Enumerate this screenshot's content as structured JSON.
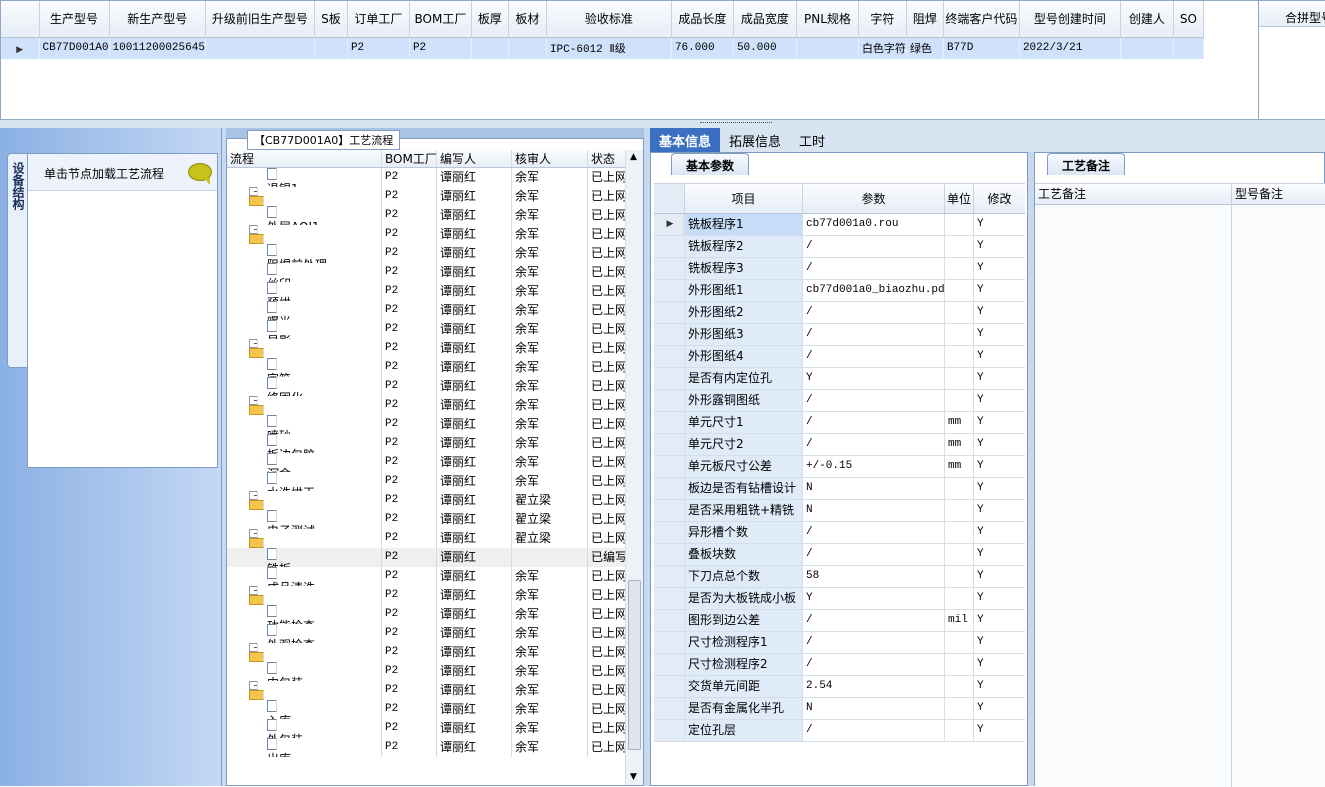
{
  "top_grid": {
    "columns": [
      "生产型号",
      "新生产型号",
      "升级前旧生产型号",
      "S板",
      "订单工厂",
      "BOM工厂",
      "板厚",
      "板材",
      "验收标准",
      "成品长度",
      "成品宽度",
      "PNL规格",
      "字符",
      "阻焊",
      "终端客户代码",
      "型号创建时间",
      "创建人",
      "SO"
    ],
    "row": [
      "CB77D001A0",
      "10011200025645",
      "",
      "",
      "P2",
      "P2",
      "",
      "",
      "IPC-6012 Ⅱ级",
      "76.000",
      "50.000",
      "",
      "白色字符",
      "绿色",
      "B77D",
      "2022/3/21",
      "",
      ""
    ],
    "right_header": "合拼型号"
  },
  "left_panel": {
    "tab_label": "设备结构",
    "hint": "单击节点加载工艺流程"
  },
  "flow_panel": {
    "title": "【CB77D001A0】工艺流程",
    "columns": [
      "流程",
      "BOM工厂",
      "编写人",
      "核审人",
      "状态"
    ],
    "rows": [
      {
        "name": "退锡1",
        "level": 2,
        "bom": "P2",
        "writer": "谭丽红",
        "reviewer": "余军",
        "status": "已上网"
      },
      {
        "name": "AOI1",
        "level": 1,
        "bom": "P2",
        "writer": "谭丽红",
        "reviewer": "余军",
        "status": "已上网"
      },
      {
        "name": "外层AOI1",
        "level": 2,
        "bom": "P2",
        "writer": "谭丽红",
        "reviewer": "余军",
        "status": "已上网"
      },
      {
        "name": "阻焊",
        "level": 1,
        "bom": "P2",
        "writer": "谭丽红",
        "reviewer": "余军",
        "status": "已上网"
      },
      {
        "name": "阻焊前处理",
        "level": 2,
        "bom": "P2",
        "writer": "谭丽红",
        "reviewer": "余军",
        "status": "已上网"
      },
      {
        "name": "丝印",
        "level": 2,
        "bom": "P2",
        "writer": "谭丽红",
        "reviewer": "余军",
        "status": "已上网"
      },
      {
        "name": "预烘",
        "level": 2,
        "bom": "P2",
        "writer": "谭丽红",
        "reviewer": "余军",
        "status": "已上网"
      },
      {
        "name": "曝光",
        "level": 2,
        "bom": "P2",
        "writer": "谭丽红",
        "reviewer": "余军",
        "status": "已上网"
      },
      {
        "name": "显影",
        "level": 2,
        "bom": "P2",
        "writer": "谭丽红",
        "reviewer": "余军",
        "status": "已上网"
      },
      {
        "name": "字符",
        "level": 1,
        "bom": "P2",
        "writer": "谭丽红",
        "reviewer": "余军",
        "status": "已上网"
      },
      {
        "name": "字符",
        "level": 2,
        "bom": "P2",
        "writer": "谭丽红",
        "reviewer": "余军",
        "status": "已上网"
      },
      {
        "name": "终固化",
        "level": 2,
        "bom": "P2",
        "writer": "谭丽红",
        "reviewer": "余军",
        "status": "已上网"
      },
      {
        "name": "沉金",
        "level": 1,
        "bom": "P2",
        "writer": "谭丽红",
        "reviewer": "余军",
        "status": "已上网"
      },
      {
        "name": "喷砂",
        "level": 2,
        "bom": "P2",
        "writer": "谭丽红",
        "reviewer": "余军",
        "status": "已上网"
      },
      {
        "name": "板边包胶",
        "level": 2,
        "bom": "P2",
        "writer": "谭丽红",
        "reviewer": "余军",
        "status": "已上网"
      },
      {
        "name": "沉金",
        "level": 2,
        "bom": "P2",
        "writer": "谭丽红",
        "reviewer": "余军",
        "status": "已上网"
      },
      {
        "name": "水洗烘干",
        "level": 2,
        "bom": "P2",
        "writer": "谭丽红",
        "reviewer": "余军",
        "status": "已上网"
      },
      {
        "name": "电子测试",
        "level": 1,
        "bom": "P2",
        "writer": "谭丽红",
        "reviewer": "翟立梁",
        "status": "已上网"
      },
      {
        "name": "电子测试",
        "level": 2,
        "bom": "P2",
        "writer": "谭丽红",
        "reviewer": "翟立梁",
        "status": "已上网"
      },
      {
        "name": "外形",
        "level": 1,
        "bom": "P2",
        "writer": "谭丽红",
        "reviewer": "翟立梁",
        "status": "已上网"
      },
      {
        "name": "铣板",
        "level": 2,
        "bom": "P2",
        "writer": "谭丽红",
        "reviewer": "",
        "status": "已编写"
      },
      {
        "name": "成品清洗",
        "level": 2,
        "bom": "P2",
        "writer": "谭丽红",
        "reviewer": "余军",
        "status": "已上网"
      },
      {
        "name": "终检",
        "level": 1,
        "bom": "P2",
        "writer": "谭丽红",
        "reviewer": "余军",
        "status": "已上网"
      },
      {
        "name": "功能检查",
        "level": 2,
        "bom": "P2",
        "writer": "谭丽红",
        "reviewer": "余军",
        "status": "已上网"
      },
      {
        "name": "外观检查",
        "level": 2,
        "bom": "P2",
        "writer": "谭丽红",
        "reviewer": "余军",
        "status": "已上网"
      },
      {
        "name": "包装",
        "level": 1,
        "bom": "P2",
        "writer": "谭丽红",
        "reviewer": "余军",
        "status": "已上网"
      },
      {
        "name": "内包装",
        "level": 2,
        "bom": "P2",
        "writer": "谭丽红",
        "reviewer": "余军",
        "status": "已上网"
      },
      {
        "name": "成品仓",
        "level": 1,
        "bom": "P2",
        "writer": "谭丽红",
        "reviewer": "余军",
        "status": "已上网"
      },
      {
        "name": "入库",
        "level": 2,
        "bom": "P2",
        "writer": "谭丽红",
        "reviewer": "余军",
        "status": "已上网"
      },
      {
        "name": "外包装",
        "level": 2,
        "bom": "P2",
        "writer": "谭丽红",
        "reviewer": "余军",
        "status": "已上网"
      },
      {
        "name": "出库",
        "level": 2,
        "bom": "P2",
        "writer": "谭丽红",
        "reviewer": "余军",
        "status": "已上网"
      }
    ]
  },
  "tabs": [
    "基本信息",
    "拓展信息",
    "工时"
  ],
  "basic_panel": {
    "group_tab": "基本参数",
    "columns": [
      "项目",
      "参数",
      "单位",
      "修改"
    ],
    "rows": [
      {
        "item": "铣板程序1",
        "param": "cb77d001a0.rou",
        "unit": "",
        "mod": "Y"
      },
      {
        "item": "铣板程序2",
        "param": "/",
        "unit": "",
        "mod": "Y"
      },
      {
        "item": "铣板程序3",
        "param": "/",
        "unit": "",
        "mod": "Y"
      },
      {
        "item": "外形图纸1",
        "param": "cb77d001a0_biaozhu.pdf",
        "unit": "",
        "mod": "Y"
      },
      {
        "item": "外形图纸2",
        "param": "/",
        "unit": "",
        "mod": "Y"
      },
      {
        "item": "外形图纸3",
        "param": "/",
        "unit": "",
        "mod": "Y"
      },
      {
        "item": "外形图纸4",
        "param": "/",
        "unit": "",
        "mod": "Y"
      },
      {
        "item": "是否有内定位孔",
        "param": "Y",
        "unit": "",
        "mod": "Y"
      },
      {
        "item": "外形露铜图纸",
        "param": "/",
        "unit": "",
        "mod": "Y"
      },
      {
        "item": "单元尺寸1",
        "param": "/",
        "unit": "mm",
        "mod": "Y"
      },
      {
        "item": "单元尺寸2",
        "param": "/",
        "unit": "mm",
        "mod": "Y"
      },
      {
        "item": "单元板尺寸公差",
        "param": "+/-0.15",
        "unit": "mm",
        "mod": "Y"
      },
      {
        "item": "板边是否有钻槽设计",
        "param": "N",
        "unit": "",
        "mod": "Y"
      },
      {
        "item": "是否采用粗铣+精铣",
        "param": "N",
        "unit": "",
        "mod": "Y"
      },
      {
        "item": "异形槽个数",
        "param": "/",
        "unit": "",
        "mod": "Y"
      },
      {
        "item": "叠板块数",
        "param": "/",
        "unit": "",
        "mod": "Y"
      },
      {
        "item": "下刀点总个数",
        "param": "58",
        "unit": "",
        "mod": "Y"
      },
      {
        "item": "是否为大板铣成小板",
        "param": "Y",
        "unit": "",
        "mod": "Y"
      },
      {
        "item": "图形到边公差",
        "param": "/",
        "unit": "mil",
        "mod": "Y"
      },
      {
        "item": "尺寸检测程序1",
        "param": "/",
        "unit": "",
        "mod": "Y"
      },
      {
        "item": "尺寸检测程序2",
        "param": "/",
        "unit": "",
        "mod": "Y"
      },
      {
        "item": "交货单元间距",
        "param": "2.54",
        "unit": "",
        "mod": "Y"
      },
      {
        "item": "是否有金属化半孔",
        "param": "N",
        "unit": "",
        "mod": "Y"
      },
      {
        "item": "定位孔层",
        "param": "/",
        "unit": "",
        "mod": "Y"
      }
    ]
  },
  "remark_panel": {
    "group_tab": "工艺备注",
    "columns": [
      "工艺备注",
      "型号备注"
    ]
  }
}
